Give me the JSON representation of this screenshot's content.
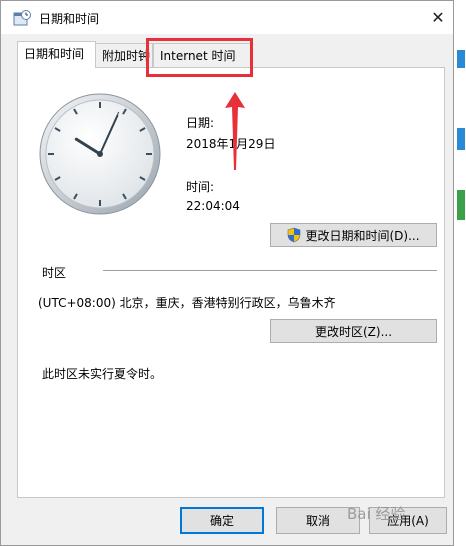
{
  "window": {
    "title": "日期和时间"
  },
  "tabs": [
    {
      "label": "日期和时间"
    },
    {
      "label": "附加时钟"
    },
    {
      "label": "Internet 时间"
    }
  ],
  "date": {
    "label": "日期:",
    "value": "2018年1月29日"
  },
  "time": {
    "label": "时间:",
    "value": "22:04:04"
  },
  "buttons": {
    "change_datetime": "更改日期和时间(D)...",
    "change_timezone": "更改时区(Z)...",
    "ok": "确定",
    "cancel": "取消",
    "apply": "应用(A)"
  },
  "timezone": {
    "section_label": "时区",
    "value": "(UTC+08:00) 北京，重庆，香港特别行政区，乌鲁木齐",
    "dst_note": "此时区未实行夏令时。"
  },
  "clock": {
    "hour": 22,
    "minute": 4,
    "second": 4
  },
  "watermark": "Bai 经验",
  "colors": {
    "highlight": "#e8303a",
    "accent": "#0078d7"
  }
}
